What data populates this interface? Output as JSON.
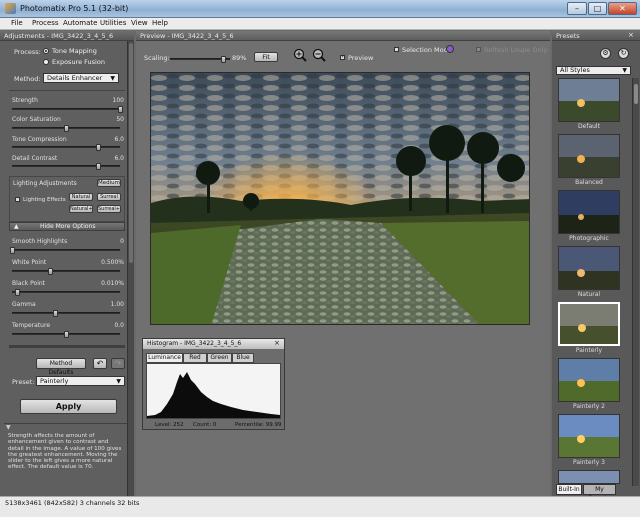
{
  "window": {
    "title": "Photomatix Pro 5.1 (32-bit)",
    "min_label": "–",
    "max_label": "□",
    "close_label": "✕"
  },
  "menu": [
    "File",
    "Process",
    "Automate",
    "Utilities",
    "View",
    "Help"
  ],
  "adjustments": {
    "header": "Adjustments - IMG_3422_3_4_5_6",
    "process_label": "Process:",
    "process_options": [
      "Tone Mapping",
      "Exposure Fusion"
    ],
    "method_label": "Method:",
    "method_value": "Details Enhancer",
    "sliders": [
      {
        "label": "Strength",
        "value": "100",
        "fraction": 1.0
      },
      {
        "label": "Color Saturation",
        "value": "50",
        "fraction": 0.5
      },
      {
        "label": "Tone Compression",
        "value": "6.0",
        "fraction": 0.8
      },
      {
        "label": "Detail Contrast",
        "value": "6.0",
        "fraction": 0.8
      }
    ],
    "lighting_label": "Lighting Adjustments",
    "lighting_value": "Medium",
    "lighting_effects_label": "Lighting Effects",
    "lighting_buttons": [
      "Natural",
      "Surreal",
      "Natural+",
      "Surreal+"
    ],
    "more_options_label": "Hide More Options",
    "more_sliders": [
      {
        "label": "Smooth Highlights",
        "value": "0",
        "fraction": 0.0
      },
      {
        "label": "White Point",
        "value": "0.500%",
        "fraction": 0.35
      },
      {
        "label": "Black Point",
        "value": "0.010%",
        "fraction": 0.05
      },
      {
        "label": "Gamma",
        "value": "1.00",
        "fraction": 0.4
      },
      {
        "label": "Temperature",
        "value": "0.0",
        "fraction": 0.5
      }
    ],
    "method_defaults_label": "Method Defaults",
    "preset_label": "Preset:",
    "preset_value": "Painterly",
    "apply_label": "Apply",
    "help_text": "Strength affects the amount of enhancement given to contrast and detail in the image. A value of 100 gives the greatest enhancement. Moving the slider to the left gives a more natural effect. The default value is 70."
  },
  "preview": {
    "header": "Preview - IMG_3422_3_4_5_6",
    "scaling_label": "Scaling:",
    "scaling_value": "89%",
    "scaling_fraction": 0.89,
    "fit_label": "Fit",
    "selection_mode_label": "Selection Mode",
    "refresh_label": "Refresh Loupe Only",
    "preview_label": "Preview"
  },
  "histogram": {
    "header": "Histogram - IMG_3422_3_4_5_6",
    "tabs": [
      "Luminance",
      "Red",
      "Green",
      "Blue"
    ],
    "level": "Level: 252",
    "count": "Count: 0",
    "percentile": "Percentile: 99.99"
  },
  "presets": {
    "header": "Presets",
    "combo_value": "All Styles",
    "items": [
      "Default",
      "Balanced",
      "Photographic",
      "Natural",
      "Painterly",
      "Painterly 2",
      "Painterly 3"
    ],
    "selected_index": 4,
    "tabs": [
      "Built-In",
      "My Presets"
    ]
  },
  "status": {
    "text": "5138x3461 (842x582) 3 channels 32 bits"
  },
  "colors": {
    "panel": "#5f5f5f",
    "title_bar": "#9fbcdd",
    "selected_border": "#ffffff"
  }
}
